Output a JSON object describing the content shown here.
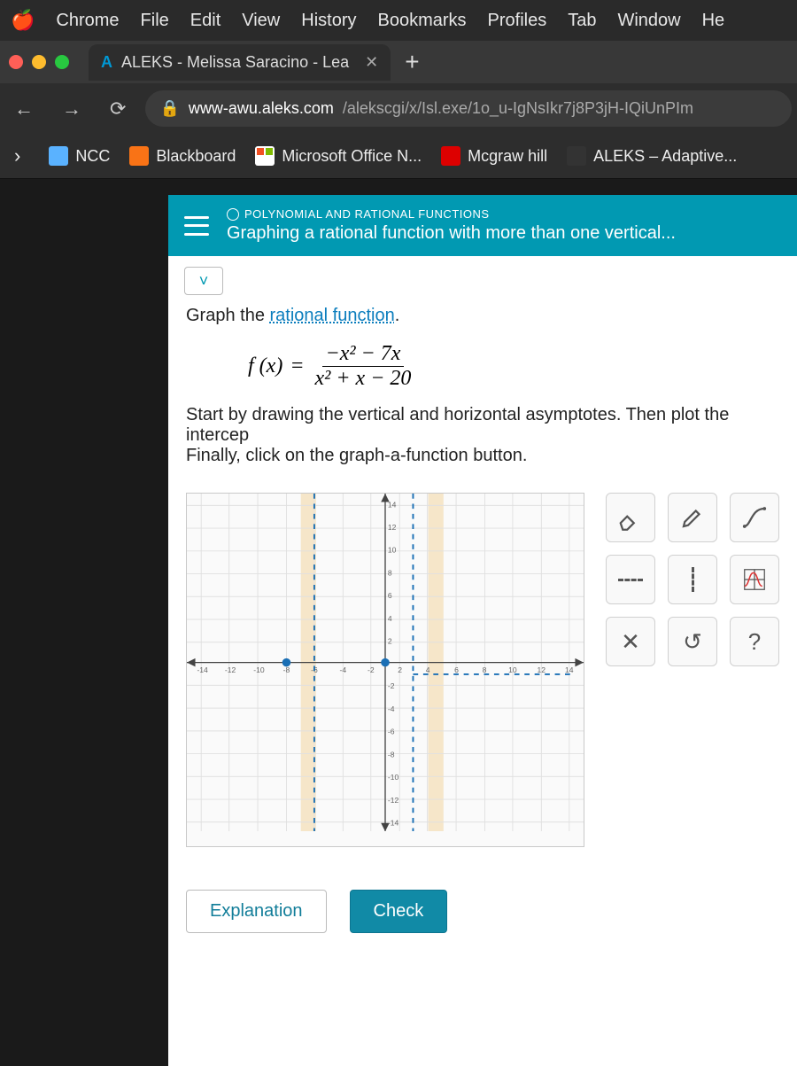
{
  "menubar": {
    "app": "Chrome",
    "items": [
      "File",
      "Edit",
      "View",
      "History",
      "Bookmarks",
      "Profiles",
      "Tab",
      "Window",
      "He"
    ]
  },
  "tab": {
    "title": "ALEKS - Melissa Saracino - Lea",
    "favicon_letter": "A"
  },
  "nav": {
    "url_domain": "www-awu.aleks.com",
    "url_path": "/alekscgi/x/Isl.exe/1o_u-IgNsIkr7j8P3jH-IQiUnPIm"
  },
  "bookmarks_bar": [
    "NCC",
    "Blackboard",
    "Microsoft Office N...",
    "Mcgraw hill",
    "ALEKS – Adaptive..."
  ],
  "topic": {
    "category": "POLYNOMIAL AND RATIONAL FUNCTIONS",
    "title": "Graphing a rational function with more than one vertical..."
  },
  "prompt": {
    "lead": "Graph the ",
    "link": "rational function",
    "tail": "."
  },
  "formula": {
    "lhs": "f (x)",
    "equals": "=",
    "num": "−x² − 7x",
    "den": "x² + x − 20"
  },
  "instructions": {
    "p1a": "Start by drawing the vertical and horizontal ",
    "p1link": "asymptotes",
    "p1b": ". Then plot the intercep",
    "p2": "Finally, click on the graph-a-function button."
  },
  "chart_data": {
    "type": "scatter",
    "xlim": [
      -14,
      14
    ],
    "ylim": [
      -14,
      14
    ],
    "xticks": [
      -14,
      -12,
      -10,
      -8,
      -6,
      -4,
      -2,
      2,
      4,
      6,
      8,
      10,
      12,
      14
    ],
    "yticks": [
      -14,
      -12,
      -10,
      -8,
      -6,
      -4,
      -2,
      2,
      4,
      6,
      8,
      10,
      12,
      14
    ],
    "vertical_asymptotes": [
      -5,
      4
    ],
    "horizontal_asymptotes": [
      -1
    ],
    "drawn_vertical_dashed": [
      -5,
      2
    ],
    "points": [
      [
        -7,
        0
      ],
      [
        0,
        0
      ]
    ]
  },
  "tools": [
    "eraser",
    "pen",
    "curve",
    "dash-h",
    "dash-v",
    "graph-fn",
    "clear",
    "reset",
    "help"
  ],
  "tool_labels": {
    "clear": "✕",
    "reset": "↺",
    "help": "?"
  },
  "buttons": {
    "explanation": "Explanation",
    "check": "Check"
  }
}
